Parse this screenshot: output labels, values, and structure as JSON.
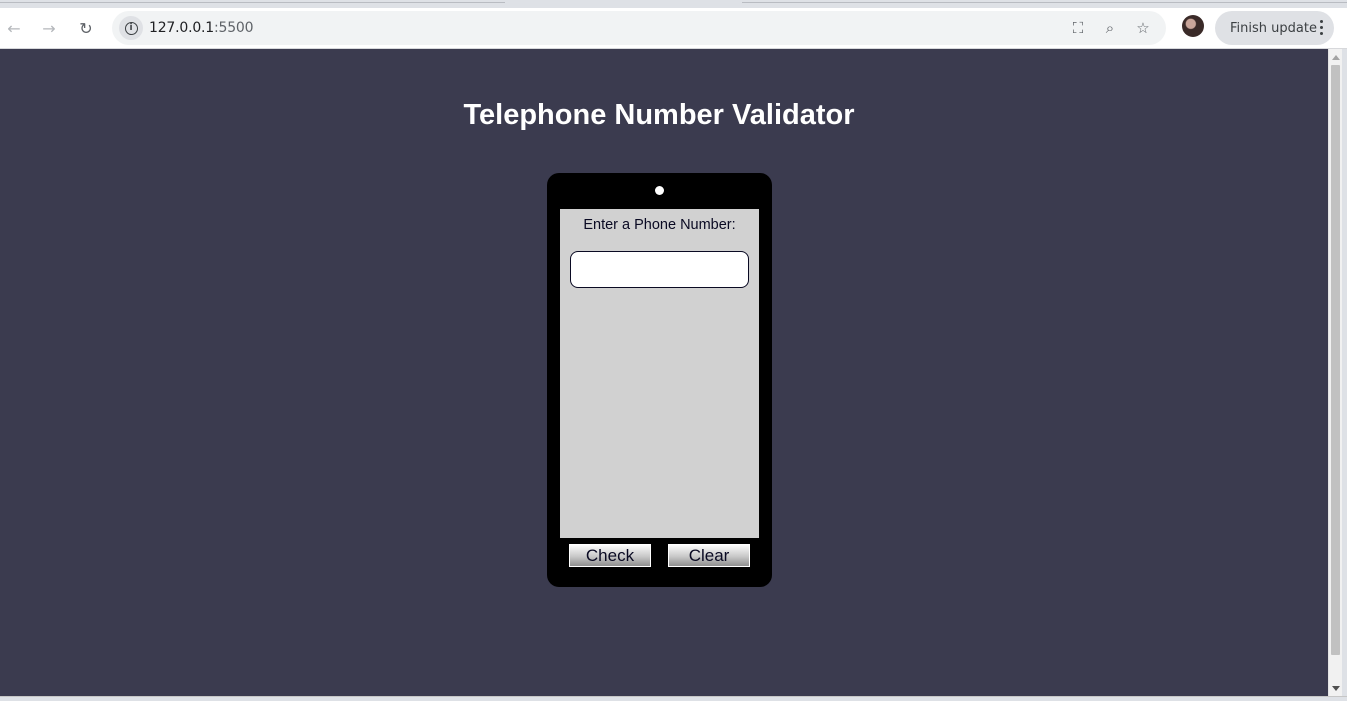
{
  "browser": {
    "url_host": "127.0.0.1",
    "url_port": ":5500",
    "update_label": "Finish update",
    "icons": {
      "back": "back-arrow-icon",
      "forward": "forward-arrow-icon",
      "reload": "reload-icon",
      "site_info": "info-icon",
      "translate": "translate-icon",
      "zoom": "zoom-icon",
      "bookmark": "star-icon",
      "menu": "kebab-menu-icon"
    },
    "glyphs": {
      "back": "←",
      "forward": "→",
      "reload": "↻",
      "info": "i",
      "translate": "⛶",
      "zoom": "⌕",
      "star": "☆"
    }
  },
  "page": {
    "title": "Telephone Number Validator",
    "background_color": "#3b3b4f",
    "prompt": "Enter a Phone Number:",
    "input_value": "",
    "check_label": "Check",
    "clear_label": "Clear"
  }
}
